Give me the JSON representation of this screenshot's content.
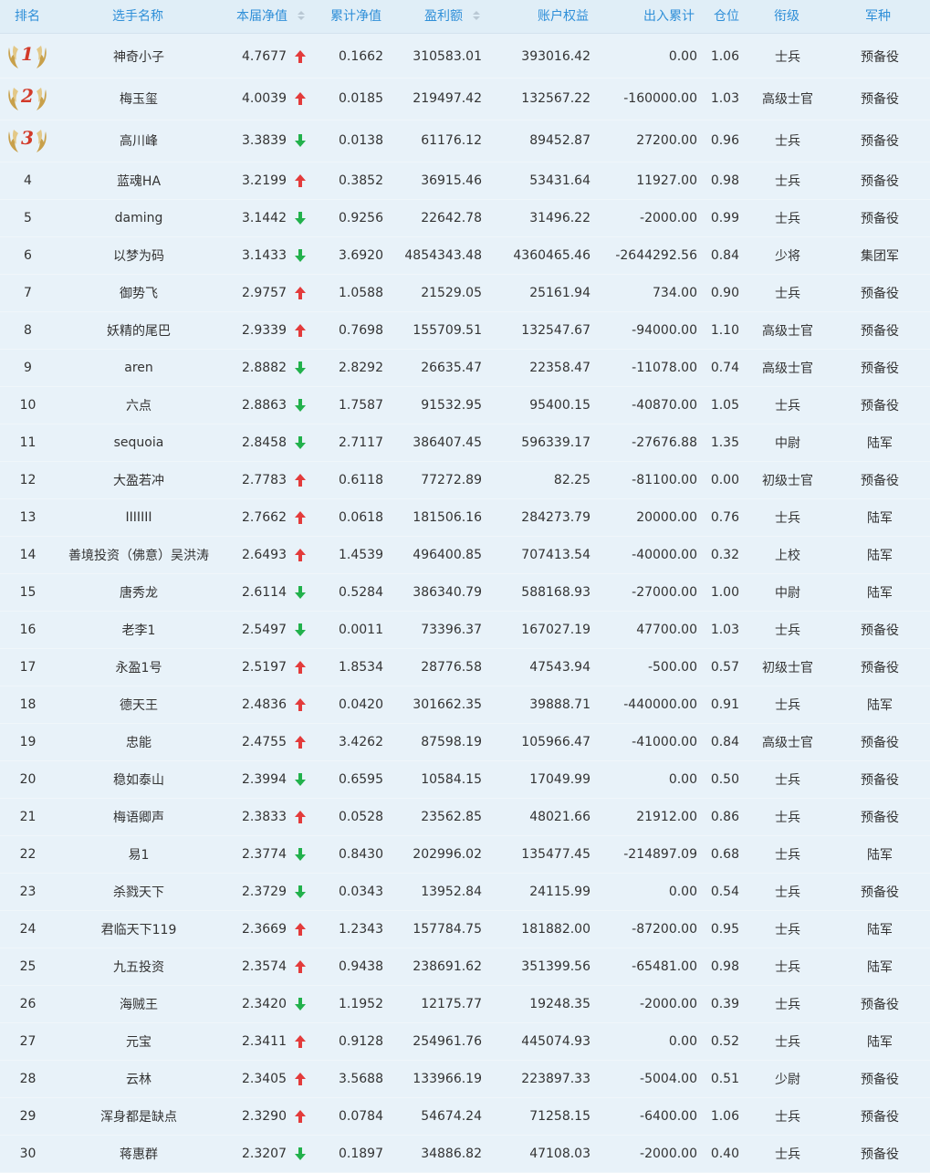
{
  "headers": {
    "rank": "排名",
    "player": "选手名称",
    "nav": "本届净值",
    "cum_nav": "累计净值",
    "profit": "盈利额",
    "equity": "账户权益",
    "inout": "出入累计",
    "position": "仓位",
    "grade": "衔级",
    "branch": "军种"
  },
  "up_color": "#e33b3b",
  "down_color": "#22b14c",
  "medal_color": "#c8a04a",
  "medal_number_color": "#d23a2a",
  "rows": [
    {
      "rank": "1",
      "name": "神奇小子",
      "nav": "4.7677",
      "dir": "up",
      "cum": "0.1662",
      "profit": "310583.01",
      "equity": "393016.42",
      "inout": "0.00",
      "pos": "1.06",
      "grade": "士兵",
      "branch": "预备役"
    },
    {
      "rank": "2",
      "name": "梅玉玺",
      "nav": "4.0039",
      "dir": "up",
      "cum": "0.0185",
      "profit": "219497.42",
      "equity": "132567.22",
      "inout": "-160000.00",
      "pos": "1.03",
      "grade": "高级士官",
      "branch": "预备役"
    },
    {
      "rank": "3",
      "name": "高川峰",
      "nav": "3.3839",
      "dir": "down",
      "cum": "0.0138",
      "profit": "61176.12",
      "equity": "89452.87",
      "inout": "27200.00",
      "pos": "0.96",
      "grade": "士兵",
      "branch": "预备役"
    },
    {
      "rank": "4",
      "name": "蓝魂HA",
      "nav": "3.2199",
      "dir": "up",
      "cum": "0.3852",
      "profit": "36915.46",
      "equity": "53431.64",
      "inout": "11927.00",
      "pos": "0.98",
      "grade": "士兵",
      "branch": "预备役"
    },
    {
      "rank": "5",
      "name": "daming",
      "nav": "3.1442",
      "dir": "down",
      "cum": "0.9256",
      "profit": "22642.78",
      "equity": "31496.22",
      "inout": "-2000.00",
      "pos": "0.99",
      "grade": "士兵",
      "branch": "预备役"
    },
    {
      "rank": "6",
      "name": "以梦为码",
      "nav": "3.1433",
      "dir": "down",
      "cum": "3.6920",
      "profit": "4854343.48",
      "equity": "4360465.46",
      "inout": "-2644292.56",
      "pos": "0.84",
      "grade": "少将",
      "branch": "集团军"
    },
    {
      "rank": "7",
      "name": "御势飞",
      "nav": "2.9757",
      "dir": "up",
      "cum": "1.0588",
      "profit": "21529.05",
      "equity": "25161.94",
      "inout": "734.00",
      "pos": "0.90",
      "grade": "士兵",
      "branch": "预备役"
    },
    {
      "rank": "8",
      "name": "妖精的尾巴",
      "nav": "2.9339",
      "dir": "up",
      "cum": "0.7698",
      "profit": "155709.51",
      "equity": "132547.67",
      "inout": "-94000.00",
      "pos": "1.10",
      "grade": "高级士官",
      "branch": "预备役"
    },
    {
      "rank": "9",
      "name": "aren",
      "nav": "2.8882",
      "dir": "down",
      "cum": "2.8292",
      "profit": "26635.47",
      "equity": "22358.47",
      "inout": "-11078.00",
      "pos": "0.74",
      "grade": "高级士官",
      "branch": "预备役"
    },
    {
      "rank": "10",
      "name": "六点",
      "nav": "2.8863",
      "dir": "down",
      "cum": "1.7587",
      "profit": "91532.95",
      "equity": "95400.15",
      "inout": "-40870.00",
      "pos": "1.05",
      "grade": "士兵",
      "branch": "预备役"
    },
    {
      "rank": "11",
      "name": "sequoia",
      "nav": "2.8458",
      "dir": "down",
      "cum": "2.7117",
      "profit": "386407.45",
      "equity": "596339.17",
      "inout": "-27676.88",
      "pos": "1.35",
      "grade": "中尉",
      "branch": "陆军"
    },
    {
      "rank": "12",
      "name": "大盈若冲",
      "nav": "2.7783",
      "dir": "up",
      "cum": "0.6118",
      "profit": "77272.89",
      "equity": "82.25",
      "inout": "-81100.00",
      "pos": "0.00",
      "grade": "初级士官",
      "branch": "预备役"
    },
    {
      "rank": "13",
      "name": "IIIIIII",
      "nav": "2.7662",
      "dir": "up",
      "cum": "0.0618",
      "profit": "181506.16",
      "equity": "284273.79",
      "inout": "20000.00",
      "pos": "0.76",
      "grade": "士兵",
      "branch": "陆军"
    },
    {
      "rank": "14",
      "name": "善境投资（佛意）吴洪涛",
      "nav": "2.6493",
      "dir": "up",
      "cum": "1.4539",
      "profit": "496400.85",
      "equity": "707413.54",
      "inout": "-40000.00",
      "pos": "0.32",
      "grade": "上校",
      "branch": "陆军"
    },
    {
      "rank": "15",
      "name": "唐秀龙",
      "nav": "2.6114",
      "dir": "down",
      "cum": "0.5284",
      "profit": "386340.79",
      "equity": "588168.93",
      "inout": "-27000.00",
      "pos": "1.00",
      "grade": "中尉",
      "branch": "陆军"
    },
    {
      "rank": "16",
      "name": "老李1",
      "nav": "2.5497",
      "dir": "down",
      "cum": "0.0011",
      "profit": "73396.37",
      "equity": "167027.19",
      "inout": "47700.00",
      "pos": "1.03",
      "grade": "士兵",
      "branch": "预备役"
    },
    {
      "rank": "17",
      "name": "永盈1号",
      "nav": "2.5197",
      "dir": "up",
      "cum": "1.8534",
      "profit": "28776.58",
      "equity": "47543.94",
      "inout": "-500.00",
      "pos": "0.57",
      "grade": "初级士官",
      "branch": "预备役"
    },
    {
      "rank": "18",
      "name": "德天王",
      "nav": "2.4836",
      "dir": "up",
      "cum": "0.0420",
      "profit": "301662.35",
      "equity": "39888.71",
      "inout": "-440000.00",
      "pos": "0.91",
      "grade": "士兵",
      "branch": "陆军"
    },
    {
      "rank": "19",
      "name": "忠能",
      "nav": "2.4755",
      "dir": "up",
      "cum": "3.4262",
      "profit": "87598.19",
      "equity": "105966.47",
      "inout": "-41000.00",
      "pos": "0.84",
      "grade": "高级士官",
      "branch": "预备役"
    },
    {
      "rank": "20",
      "name": "稳如泰山",
      "nav": "2.3994",
      "dir": "down",
      "cum": "0.6595",
      "profit": "10584.15",
      "equity": "17049.99",
      "inout": "0.00",
      "pos": "0.50",
      "grade": "士兵",
      "branch": "预备役"
    },
    {
      "rank": "21",
      "name": "梅语卿声",
      "nav": "2.3833",
      "dir": "up",
      "cum": "0.0528",
      "profit": "23562.85",
      "equity": "48021.66",
      "inout": "21912.00",
      "pos": "0.86",
      "grade": "士兵",
      "branch": "预备役"
    },
    {
      "rank": "22",
      "name": "易1",
      "nav": "2.3774",
      "dir": "down",
      "cum": "0.8430",
      "profit": "202996.02",
      "equity": "135477.45",
      "inout": "-214897.09",
      "pos": "0.68",
      "grade": "士兵",
      "branch": "陆军"
    },
    {
      "rank": "23",
      "name": "杀戮天下",
      "nav": "2.3729",
      "dir": "down",
      "cum": "0.0343",
      "profit": "13952.84",
      "equity": "24115.99",
      "inout": "0.00",
      "pos": "0.54",
      "grade": "士兵",
      "branch": "预备役"
    },
    {
      "rank": "24",
      "name": "君临天下119",
      "nav": "2.3669",
      "dir": "up",
      "cum": "1.2343",
      "profit": "157784.75",
      "equity": "181882.00",
      "inout": "-87200.00",
      "pos": "0.95",
      "grade": "士兵",
      "branch": "陆军"
    },
    {
      "rank": "25",
      "name": "九五投资",
      "nav": "2.3574",
      "dir": "up",
      "cum": "0.9438",
      "profit": "238691.62",
      "equity": "351399.56",
      "inout": "-65481.00",
      "pos": "0.98",
      "grade": "士兵",
      "branch": "陆军"
    },
    {
      "rank": "26",
      "name": "海贼王",
      "nav": "2.3420",
      "dir": "down",
      "cum": "1.1952",
      "profit": "12175.77",
      "equity": "19248.35",
      "inout": "-2000.00",
      "pos": "0.39",
      "grade": "士兵",
      "branch": "预备役"
    },
    {
      "rank": "27",
      "name": "元宝",
      "nav": "2.3411",
      "dir": "up",
      "cum": "0.9128",
      "profit": "254961.76",
      "equity": "445074.93",
      "inout": "0.00",
      "pos": "0.52",
      "grade": "士兵",
      "branch": "陆军"
    },
    {
      "rank": "28",
      "name": "云林",
      "nav": "2.3405",
      "dir": "up",
      "cum": "3.5688",
      "profit": "133966.19",
      "equity": "223897.33",
      "inout": "-5004.00",
      "pos": "0.51",
      "grade": "少尉",
      "branch": "预备役"
    },
    {
      "rank": "29",
      "name": "浑身都是缺点",
      "nav": "2.3290",
      "dir": "up",
      "cum": "0.0784",
      "profit": "54674.24",
      "equity": "71258.15",
      "inout": "-6400.00",
      "pos": "1.06",
      "grade": "士兵",
      "branch": "预备役"
    },
    {
      "rank": "30",
      "name": "蒋惠群",
      "nav": "2.3207",
      "dir": "down",
      "cum": "0.1897",
      "profit": "34886.82",
      "equity": "47108.03",
      "inout": "-2000.00",
      "pos": "0.40",
      "grade": "士兵",
      "branch": "预备役"
    }
  ]
}
